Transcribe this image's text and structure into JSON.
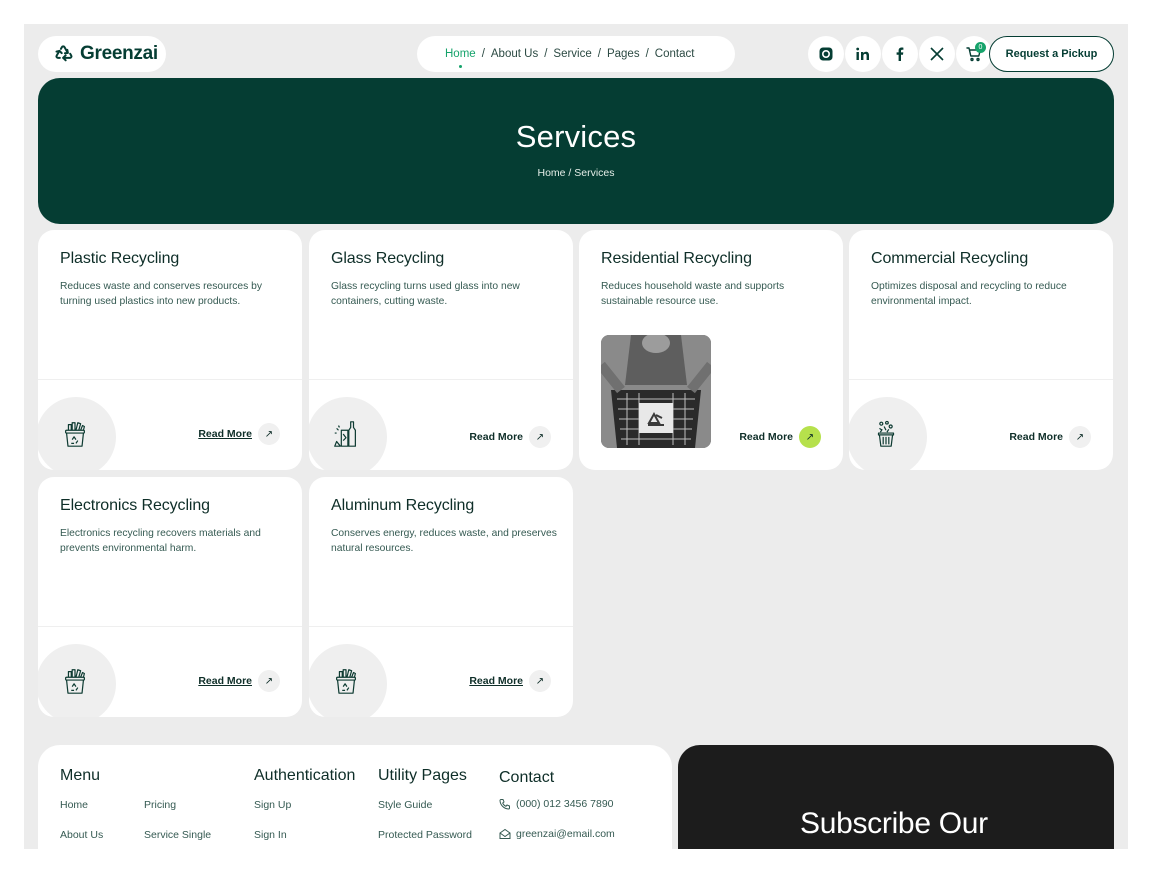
{
  "brand": {
    "name": "Greenzai"
  },
  "nav": {
    "items": [
      {
        "label": "Home",
        "active": true
      },
      {
        "label": "About Us",
        "active": false
      },
      {
        "label": "Service",
        "active": false
      },
      {
        "label": "Pages",
        "active": false
      },
      {
        "label": "Contact",
        "active": false
      }
    ],
    "separator": "/"
  },
  "header_icons": [
    "instagram-icon",
    "linkedin-icon",
    "facebook-icon",
    "x-icon",
    "cart-icon"
  ],
  "cart": {
    "count": "0"
  },
  "pickup_button": "Request a Pickup",
  "hero": {
    "title": "Services",
    "breadcrumb": "Home / Services"
  },
  "services": [
    {
      "title": "Plastic Recycling",
      "description": "Reduces waste and conserves resources by turning used plastics into new products.",
      "read_more": "Read More",
      "icon": "recycle-bin-icon"
    },
    {
      "title": "Glass Recycling",
      "description": "Glass recycling turns used glass into new containers, cutting waste.",
      "read_more": "Read More",
      "icon": "glass-bottles-icon"
    },
    {
      "title": "Residential Recycling",
      "description": "Reduces household waste and supports sustainable resource use.",
      "read_more": "Read More",
      "icon": "recycling-crate-photo"
    },
    {
      "title": "Commercial Recycling",
      "description": "Optimizes disposal and recycling to reduce environmental impact.",
      "read_more": "Read More",
      "icon": "trash-bin-icon"
    },
    {
      "title": "Electronics Recycling",
      "description": "Electronics recycling recovers materials and prevents environmental harm.",
      "read_more": "Read More",
      "icon": "recycle-bin-icon"
    },
    {
      "title": "Aluminum Recycling",
      "description": "Conserves energy, reduces waste, and preserves natural resources.",
      "read_more": "Read More",
      "icon": "recycle-bin-icon"
    }
  ],
  "footer": {
    "menu": {
      "title": "Menu",
      "links": [
        "Home",
        "Pricing",
        "About Us",
        "Service Single"
      ]
    },
    "authentication": {
      "title": "Authentication",
      "links": [
        "Sign Up",
        "Sign In"
      ]
    },
    "utility": {
      "title": "Utility Pages",
      "links": [
        "Style Guide",
        "Protected Password"
      ]
    },
    "contact": {
      "title": "Contact",
      "phone": "(000) 012 3456 7890",
      "email": "greenzai@email.com"
    },
    "subscribe_title": "Subscribe Our"
  },
  "colors": {
    "primary": "#053d33",
    "accent": "#16a36b",
    "lime": "#b6e14c",
    "background": "#ececec",
    "dark": "#1c1c1c"
  }
}
